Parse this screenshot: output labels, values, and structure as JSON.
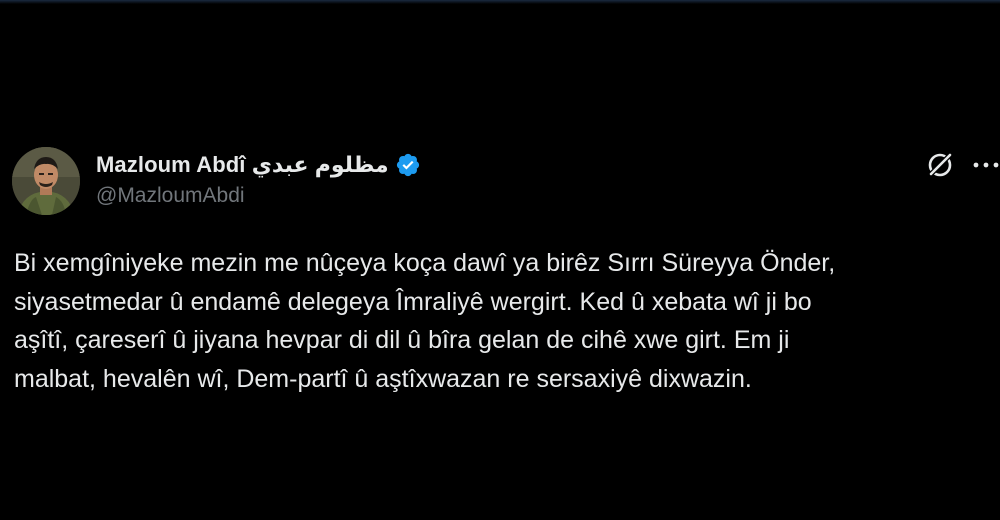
{
  "tweet": {
    "author": {
      "display_name": "Mazloum Abdî مظلوم عبدي",
      "handle": "@MazloumAbdi",
      "verified": true,
      "avatar_icon": "avatar-photo"
    },
    "actions": {
      "grok_icon": "grok-icon",
      "more_icon": "more-icon"
    },
    "text_lines": [
      "Bi xemgîniyeke mezin me nûçeya koça dawî ya birêz Sırrı Süreyya Önder,",
      "siyasetmedar û endamê delegeya Îmraliyê wergirt. Ked û xebata wî ji bo",
      "aşîtî, çareserî û jiyana hevpar di dil û bîra gelan de cihê xwe girt. Em ji",
      "malbat, hevalên wî, Dem-partî û aştîxwazan re sersaxiyê dixwazin."
    ]
  },
  "colors": {
    "background": "#000000",
    "text_primary": "#e7e9ea",
    "text_secondary": "#71767b",
    "verified_badge": "#1d9bf0"
  }
}
